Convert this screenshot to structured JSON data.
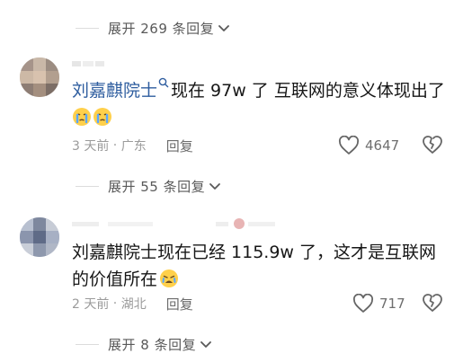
{
  "expand_top": {
    "label": "展开 269 条回复"
  },
  "comment1": {
    "mention": "刘嘉麒院士",
    "text": "现在 97w 了  互联网的意义体现出了",
    "time": "3 天前",
    "location": "广东",
    "reply_label": "回复",
    "likes": "4647"
  },
  "expand_mid": {
    "label": "展开 55 条回复"
  },
  "comment2": {
    "text": "刘嘉麒院士现在已经 115.9w 了，这才是互联网的价值所在",
    "time": "2 天前",
    "location": "湖北",
    "reply_label": "回复",
    "likes": "717"
  },
  "expand_bottom": {
    "label": "展开 8 条回复"
  },
  "icons": {
    "heart": "heart-icon",
    "dislike": "broken-heart-icon",
    "chevron": "chevron-down-icon",
    "emoji_cry": "crying-face-emoji",
    "emoji_sob": "weary-face-emoji"
  },
  "colors": {
    "mention": "#2e5d9f",
    "meta": "#9b9b9b"
  }
}
